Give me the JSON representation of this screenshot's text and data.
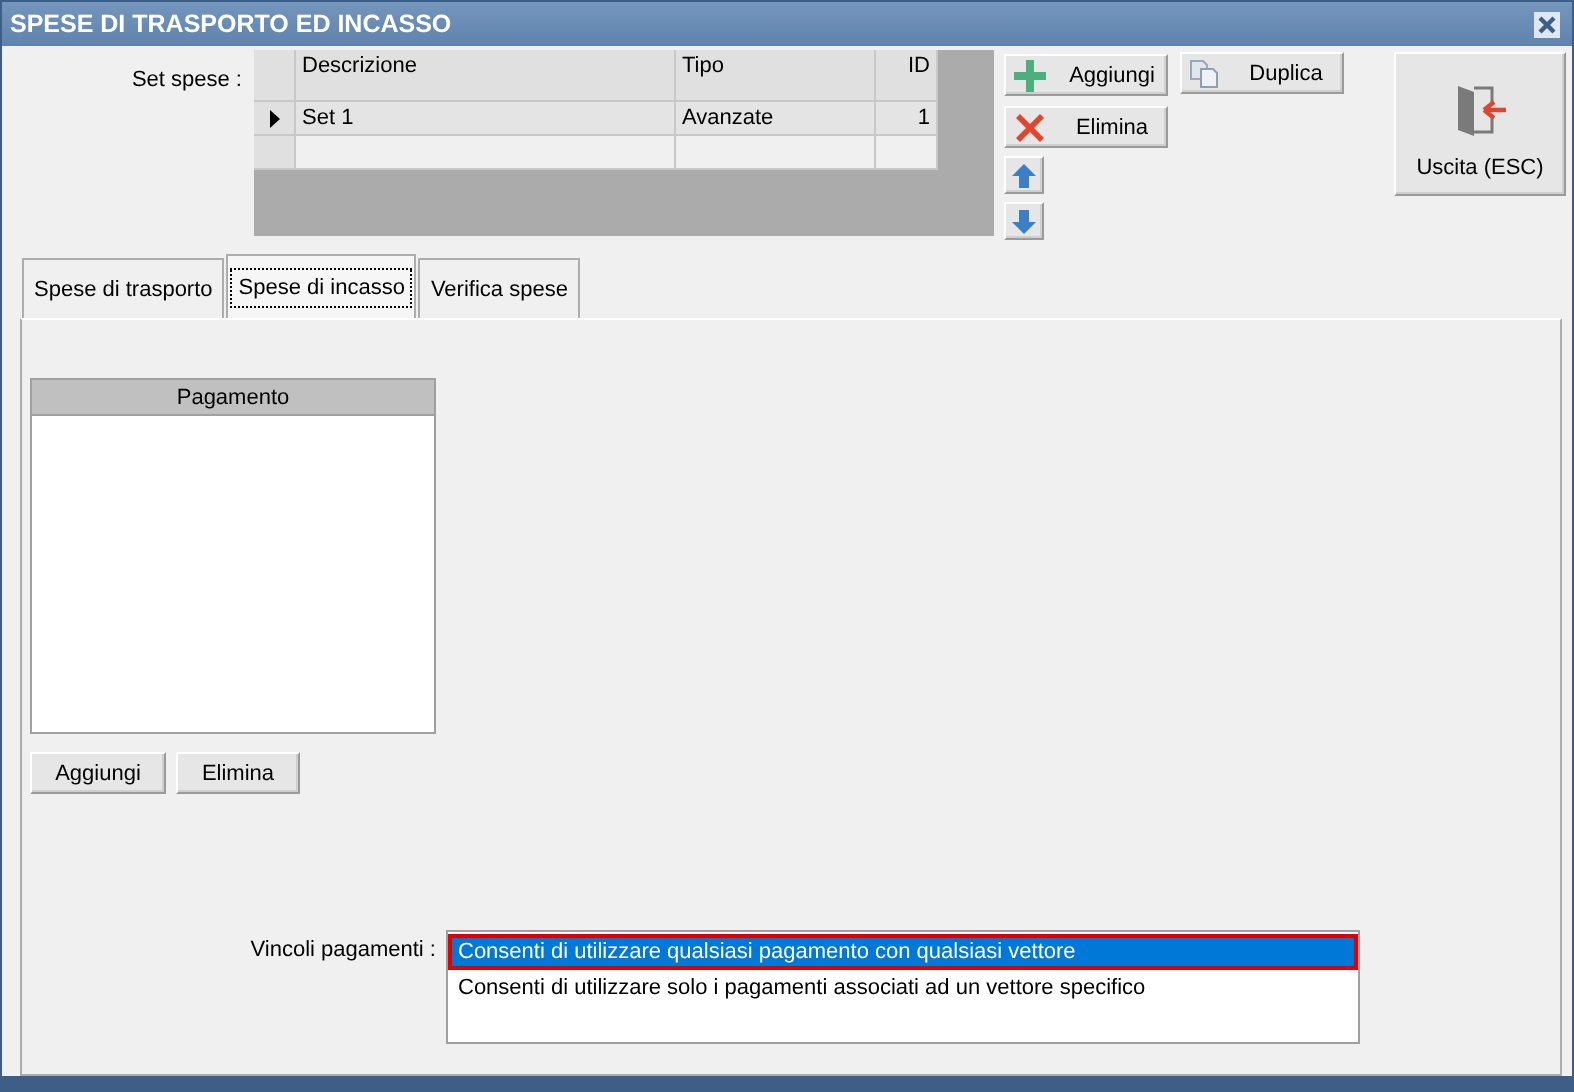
{
  "window": {
    "title": "SPESE DI TRASPORTO ED INCASSO"
  },
  "set_spese": {
    "label": "Set spese :",
    "columns": [
      "Descrizione",
      "Tipo",
      "ID"
    ],
    "rows": [
      {
        "descrizione": "Set 1",
        "tipo": "Avanzate",
        "id": "1",
        "current": true
      }
    ]
  },
  "set_buttons": [
    {
      "label": "Aggiungi",
      "kind": "add"
    },
    {
      "label": "Elimina",
      "kind": "delete"
    },
    {
      "label": "Duplica",
      "kind": "duplicate"
    }
  ],
  "exit_button": {
    "label": "Uscita (ESC)"
  },
  "tabs": [
    {
      "label": "Spese di trasporto",
      "selected": false
    },
    {
      "label": "Spese di incasso",
      "selected": true
    },
    {
      "label": "Verifica spese",
      "selected": false
    }
  ],
  "payments": {
    "column": "Pagamento",
    "buttons": [
      "Aggiungi",
      "Elimina"
    ]
  },
  "vincoli": {
    "label": "Vincoli pagamenti :",
    "options": [
      {
        "label": "Consenti di utilizzare qualsiasi pagamento con qualsiasi vettore",
        "selected": true
      },
      {
        "label": "Consenti di utilizzare solo i pagamenti associati ad un vettore specifico",
        "selected": false
      }
    ]
  }
}
